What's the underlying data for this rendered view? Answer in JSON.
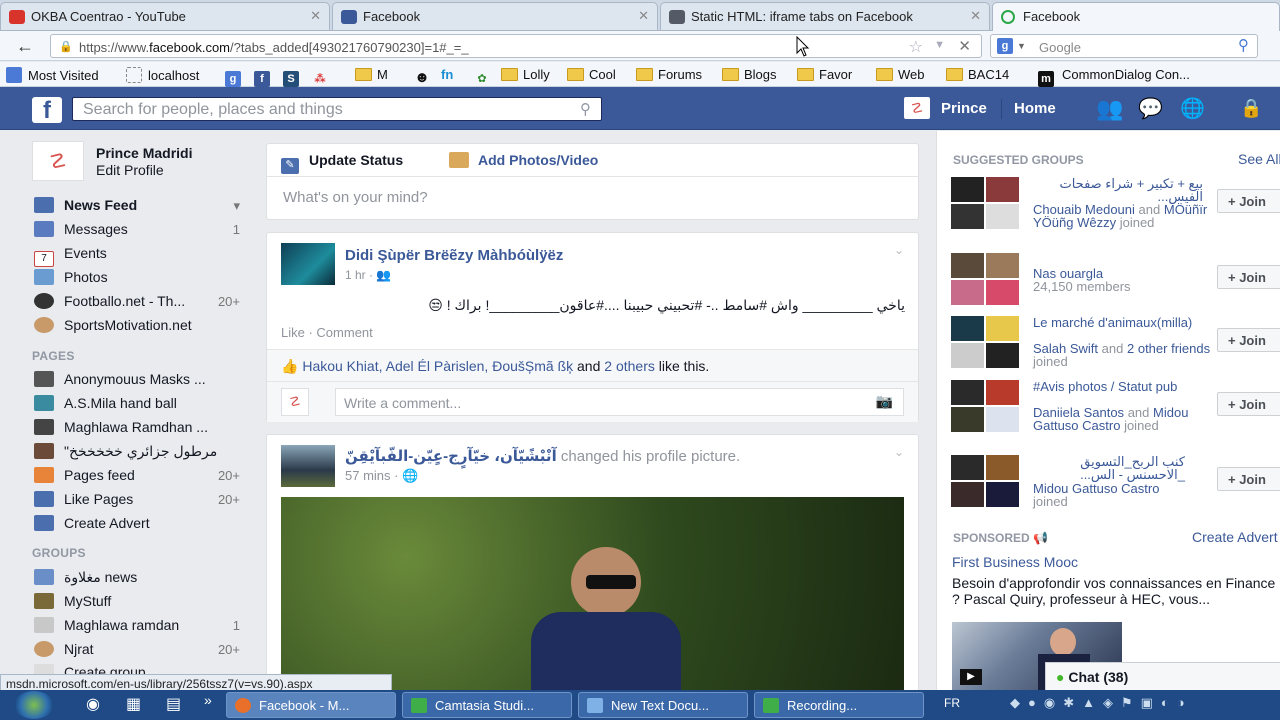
{
  "browser": {
    "tabs": [
      {
        "title": "OKBA Coentrao - YouTube",
        "icon_color": "#d9342b"
      },
      {
        "title": "Facebook",
        "icon_color": "#3b5998"
      },
      {
        "title": "Static HTML: iframe tabs on Facebook",
        "icon_color": "#555b66"
      },
      {
        "title": "Facebook",
        "icon_color": "#2aa84a"
      }
    ],
    "url_prefix": "https://www.",
    "url_domain": "facebook.com",
    "url_rest": "/?tabs_added[493021760790230]=1#_=_",
    "search_placeholder": "Google",
    "bookmarks": [
      "Most Visited",
      "localhost",
      "M",
      "fn",
      "Lolly",
      "Cool",
      "Forums",
      "Blogs",
      "Favor",
      "Web",
      "BAC14",
      "CommonDialog Con..."
    ]
  },
  "facebook": {
    "search_placeholder": "Search for people, places and things",
    "user_name": "Prince",
    "home_label": "Home",
    "left": {
      "profile_name": "Prince Madridi",
      "edit_profile": "Edit Profile",
      "favorites": [
        {
          "label": "News Feed",
          "count": ""
        },
        {
          "label": "Messages",
          "count": "1"
        },
        {
          "label": "Events",
          "count": ""
        },
        {
          "label": "Photos",
          "count": ""
        },
        {
          "label": "Footballo.net - Th...",
          "count": "20+"
        },
        {
          "label": "SportsMotivation.net",
          "count": ""
        }
      ],
      "pages_heading": "PAGES",
      "pages": [
        {
          "label": "Anonymouus Masks ...",
          "count": ""
        },
        {
          "label": "A.S.Mila hand ball",
          "count": ""
        },
        {
          "label": "Maghlawa Ramdhan ...",
          "count": ""
        },
        {
          "label": "\"مرطول جزائري خخخخخخ",
          "count": ""
        },
        {
          "label": "Pages feed",
          "count": "20+"
        },
        {
          "label": "Like Pages",
          "count": "20+"
        },
        {
          "label": "Create Advert",
          "count": ""
        }
      ],
      "groups_heading": "GROUPS",
      "groups": [
        {
          "label": "مغلاوة news",
          "count": ""
        },
        {
          "label": "MyStuff",
          "count": ""
        },
        {
          "label": "Maghlawa ramdan",
          "count": "1"
        },
        {
          "label": "Njrat",
          "count": "20+"
        },
        {
          "label": "Create group",
          "count": ""
        }
      ]
    },
    "composer": {
      "update_status": "Update Status",
      "add_photos": "Add Photos/Video",
      "placeholder": "What's on your mind?"
    },
    "post1": {
      "author": "Didi Şùpër Brëẽzy Màhbóùlÿëz",
      "time": "1 hr",
      "text": "ياخي _________ واش #سامط ..- #تحبيني حبيبنا ....#عاقون_________! براك ! 😒",
      "like": "Like",
      "comment": "Comment",
      "likers_names": "Hakou Khiat, Adel Él Pàrislen, ĐoušȘmã ßķ",
      "likers_and": "and",
      "likers_others": "2 others",
      "likers_suffix": "like this.",
      "comment_placeholder": "Write a comment..."
    },
    "post2": {
      "author": "آنْبْشًيّآن، خيّآرٍج-عٍيّن-الفّبآيْقِنّ",
      "action": "changed his profile picture.",
      "time": "57 mins"
    },
    "right": {
      "suggested_heading": "SUGGESTED GROUPS",
      "see_all": "See All",
      "join_label": "+ Join",
      "groups": [
        {
          "title": "بيع + تكبير + شراء صفحات الفيس...",
          "sub_link": "Chouaib Medouni",
          "sub_and": "and",
          "sub_link2": "MÖüñïr YÖüñg Wêzzy",
          "sub_tail": "joined"
        },
        {
          "title": "Nas ouargla",
          "sub_link": "",
          "sub_and": "",
          "sub_link2": "",
          "sub_tail": "24,150 members"
        },
        {
          "title": "Le marché d'animaux(milla)",
          "sub_link": "Salah Swift",
          "sub_and": "and",
          "sub_link2": "2 other friends",
          "sub_tail": "joined"
        },
        {
          "title": "#Avis photos / Statut pub",
          "sub_link": "Daniiela Santos",
          "sub_and": "and",
          "sub_link2": "Midou Gattuso Castro",
          "sub_tail": "joined"
        },
        {
          "title": "كنب الربح_التسويق _الاحسنس - الس...",
          "sub_link": "",
          "sub_and": "",
          "sub_link2": "Midou Gattuso Castro",
          "sub_tail": "joined"
        }
      ],
      "sponsored_heading": "SPONSORED",
      "create_advert": "Create Advert",
      "ad_title": "First Business Mooc",
      "ad_text": "Besoin d'approfondir vos connaissances en Finance ? Pascal Quiry, professeur à HEC, vous...",
      "chat_label": "Chat (38)"
    }
  },
  "status_url": "msdn.microsoft.com/en-us/library/256tssz7(v=vs.90).aspx",
  "taskbar": {
    "items": [
      {
        "label": "Facebook - M...",
        "icon_color": "#e8702a"
      },
      {
        "label": "Camtasia Studi...",
        "icon_color": "#3fae49"
      },
      {
        "label": "New Text Docu...",
        "icon_color": "#7fb0e6"
      },
      {
        "label": "Recording...",
        "icon_color": "#3fae49"
      }
    ],
    "lang": "FR"
  }
}
